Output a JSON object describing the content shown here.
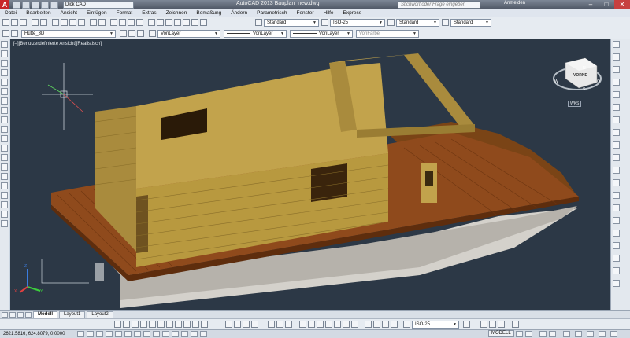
{
  "titlebar": {
    "logo": "A",
    "workspace": "Dick CAD",
    "title": "AutoCAD 2013   Bauplan_new.dwg",
    "search_placeholder": "Stichwort oder Frage eingeben",
    "login": "Anmelden",
    "min": "–",
    "max": "□",
    "close": "✕"
  },
  "menu": [
    "Datei",
    "Bearbeiten",
    "Ansicht",
    "Einfügen",
    "Format",
    "Extras",
    "Zeichnen",
    "Bemaßung",
    "Ändern",
    "Parametrisch",
    "Fenster",
    "Hilfe",
    "Express"
  ],
  "toolbar1": {
    "textstyle": "Standard",
    "dimstyle": "ISO-25",
    "tablestyle": "Standard",
    "mleaderstyle": "Standard"
  },
  "toolbar2": {
    "layer": "Hütte_3D",
    "color": "VonLayer",
    "linetype": "VonLayer",
    "lineweight": "VonLayer",
    "plotstyle": "VonFarbe"
  },
  "viewport": {
    "label": "[–][Benutzerdefinierte Ansicht][Realistisch]",
    "viewcube_face": "VORNE",
    "wcs": "WKS",
    "compass": {
      "n": "N",
      "s": "S",
      "e": "O",
      "w": "W"
    },
    "ucs": {
      "x": "X",
      "y": "Y",
      "z": "Z"
    }
  },
  "tabs": [
    "Modell",
    "Layout1",
    "Layout2"
  ],
  "active_tab": "Modell",
  "bottom_toolbar": {
    "dimstyle": "ISO-25"
  },
  "status": {
    "coords": "2621.5816, 624.8079, 0.0000",
    "space": "MODELL"
  },
  "colors": {
    "viewport_bg": "#2c3846",
    "wood": "#a98b3d",
    "deck": "#8f4a1c",
    "hull": "#d9d6d0"
  }
}
